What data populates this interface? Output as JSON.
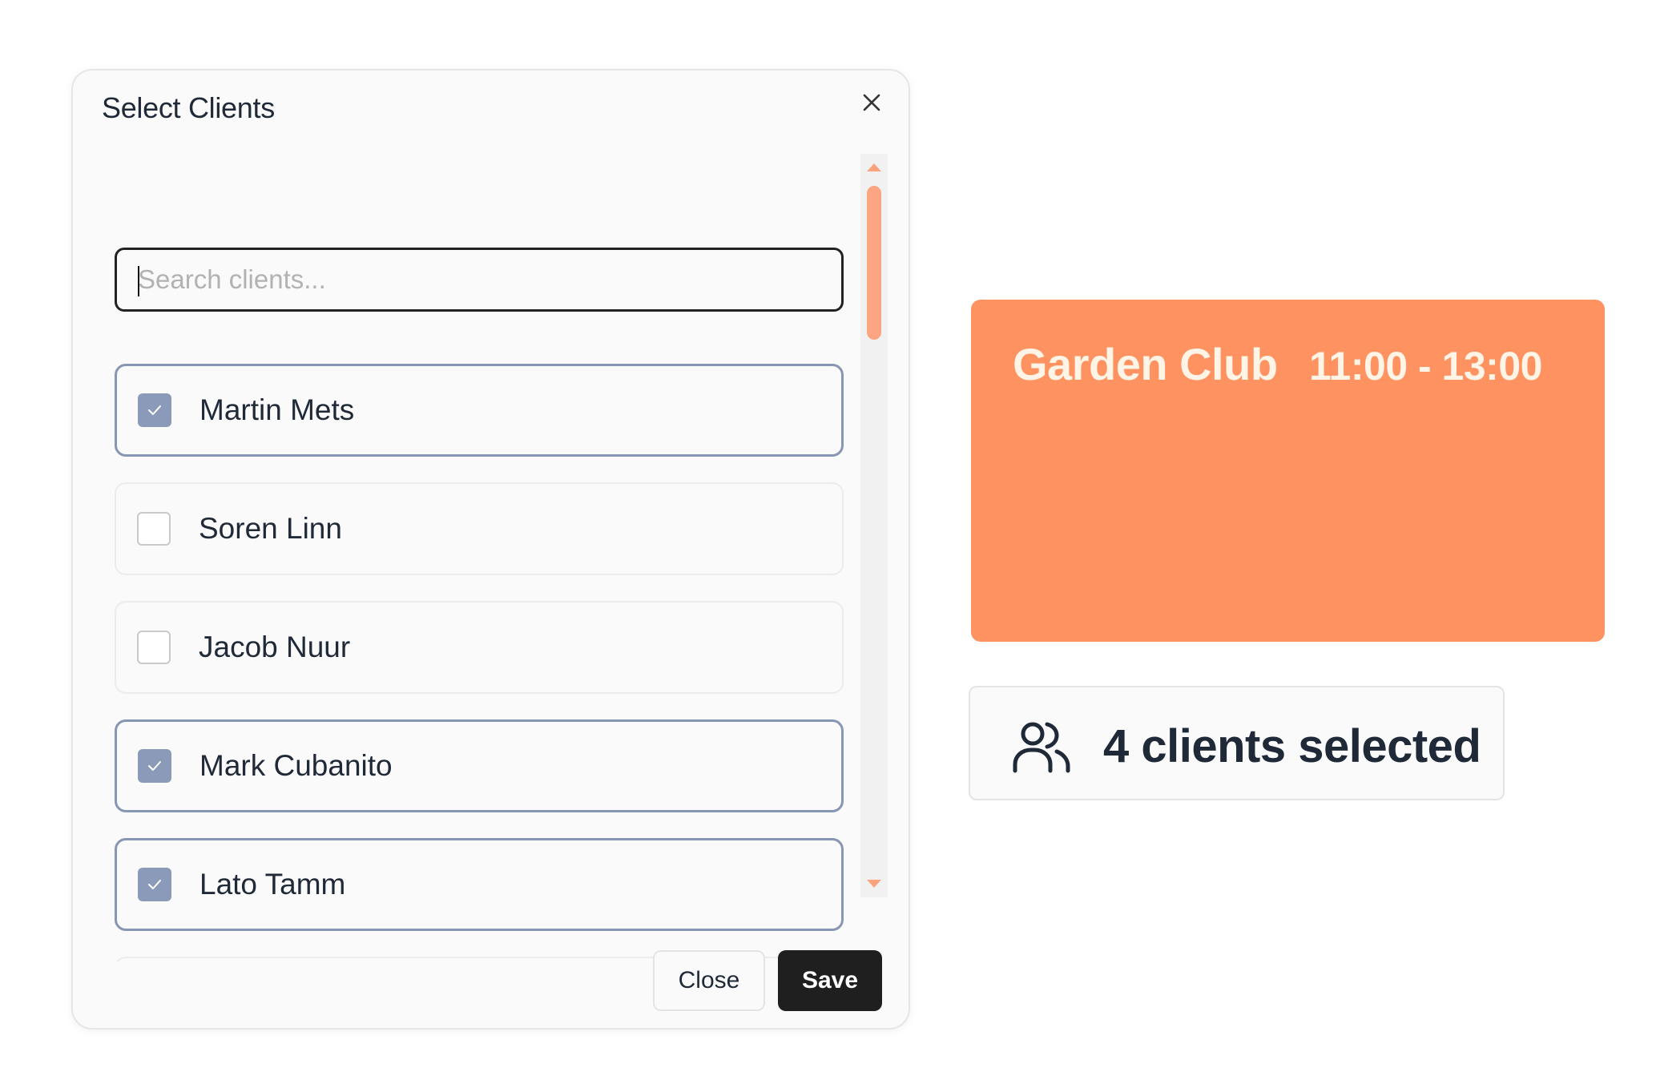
{
  "dialog": {
    "title": "Select Clients",
    "close_icon": "close-icon",
    "search": {
      "placeholder": "Search clients...",
      "value": ""
    },
    "clients": [
      {
        "name": "Martin Mets",
        "selected": true
      },
      {
        "name": "Soren Linn",
        "selected": false
      },
      {
        "name": "Jacob Nuur",
        "selected": false
      },
      {
        "name": "Mark Cubanito",
        "selected": true
      },
      {
        "name": "Lato Tamm",
        "selected": true
      }
    ],
    "footer": {
      "close_label": "Close",
      "save_label": "Save"
    }
  },
  "event": {
    "title": "Garden Club",
    "time": "11:00 - 13:00",
    "color": "#fe9260"
  },
  "summary": {
    "icon": "users-icon",
    "text": "4 clients selected"
  },
  "colors": {
    "accent": "#fba583",
    "checkbox_checked": "#8b9ab8",
    "primary_button": "#1f1f1f"
  }
}
